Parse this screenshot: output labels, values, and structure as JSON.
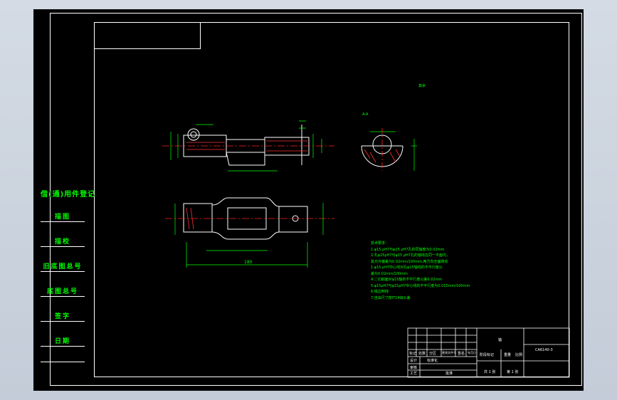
{
  "side_table": {
    "title": "借(通)用件登记",
    "rows": [
      "描图",
      "描校",
      "旧底图总号",
      "底图总号",
      "签字",
      "日期"
    ]
  },
  "roughness_mark": "其余",
  "section_label": "A-A",
  "overall_dim": "180",
  "tech_notes": {
    "heading": "技术要求：",
    "lines": [
      "1.φ15 ρH7与φ15 ρH7孔的同轴度为0.02mm",
      "2.孔φ25ρH7与φ15 ρH7孔的轴线在同一平面内，",
      "其允许偏差为0.02mm/100mm,两方向全面跳动",
      "1.φ15 ρH7中心线对孔φ15轴线的不平行度公",
      "差为0.02mm/100mm",
      "4.二切削面对φ15轴的不平行度公差0.02mm",
      "5.φ15ρH7与φ15ρH7中心线的不平行度为0.015mm/100mm",
      "6.锐边倒钝",
      "7.自由尺寸按IT14级公差"
    ]
  },
  "title_block": {
    "part_name": "轴",
    "drawing_code": "CA6140-3",
    "labels": [
      "标记",
      "处数",
      "分区",
      "更改文件号",
      "签名",
      "年月日",
      "设计",
      "标准化",
      "阶段标记",
      "重量",
      "比例"
    ],
    "bottom_left": [
      "审核",
      "工艺"
    ],
    "bottom_mid": "批准",
    "sheet_count": "共 1 张",
    "sheet_num": "第 1 张"
  }
}
